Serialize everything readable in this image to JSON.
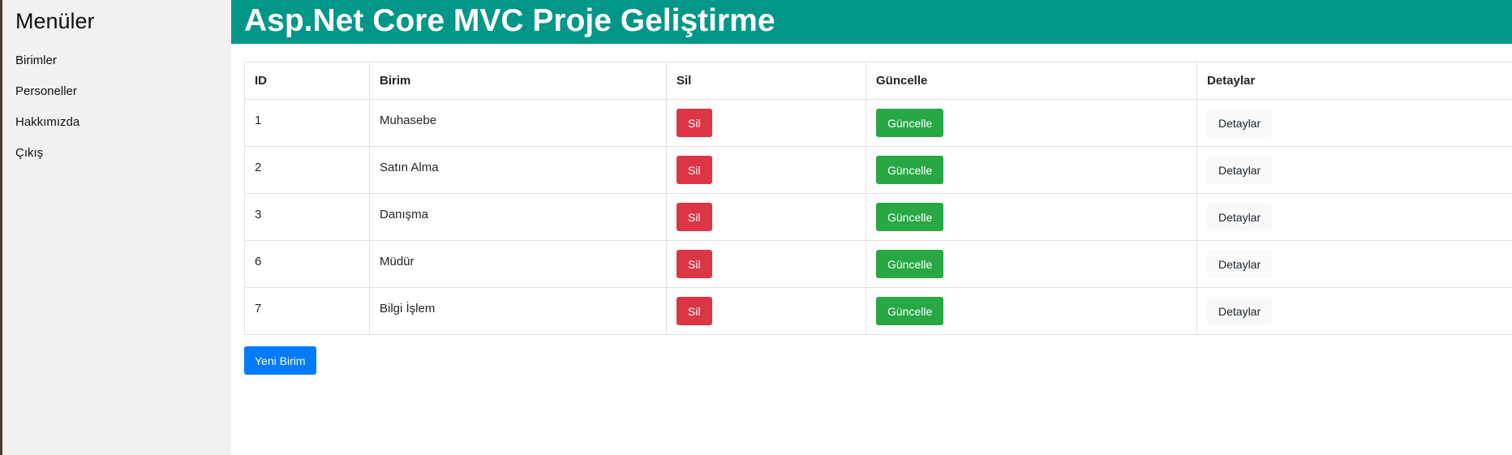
{
  "sidebar": {
    "title": "Menüler",
    "items": [
      {
        "label": "Birimler"
      },
      {
        "label": "Personeller"
      },
      {
        "label": "Hakkımızda"
      },
      {
        "label": "Çıkış"
      }
    ]
  },
  "header": {
    "title": "Asp.Net Core MVC Proje Geliştirme"
  },
  "table": {
    "columns": [
      "ID",
      "Birim",
      "Sil",
      "Güncelle",
      "Detaylar"
    ],
    "rows": [
      {
        "id": "1",
        "birim": "Muhasebe",
        "sil": "Sil",
        "guncelle": "Güncelle",
        "detaylar": "Detaylar"
      },
      {
        "id": "2",
        "birim": "Satın Alma",
        "sil": "Sil",
        "guncelle": "Güncelle",
        "detaylar": "Detaylar"
      },
      {
        "id": "3",
        "birim": "Danışma",
        "sil": "Sil",
        "guncelle": "Güncelle",
        "detaylar": "Detaylar"
      },
      {
        "id": "6",
        "birim": "Müdür",
        "sil": "Sil",
        "guncelle": "Güncelle",
        "detaylar": "Detaylar"
      },
      {
        "id": "7",
        "birim": "Bilgi İşlem",
        "sil": "Sil",
        "guncelle": "Güncelle",
        "detaylar": "Detaylar"
      }
    ]
  },
  "actions": {
    "new_label": "Yeni Birim"
  },
  "colors": {
    "header_bg": "#009688",
    "sidebar_bg": "#f1f1f1",
    "danger": "#dc3545",
    "success": "#28a745",
    "light": "#f8f9fa",
    "primary": "#007bff"
  }
}
